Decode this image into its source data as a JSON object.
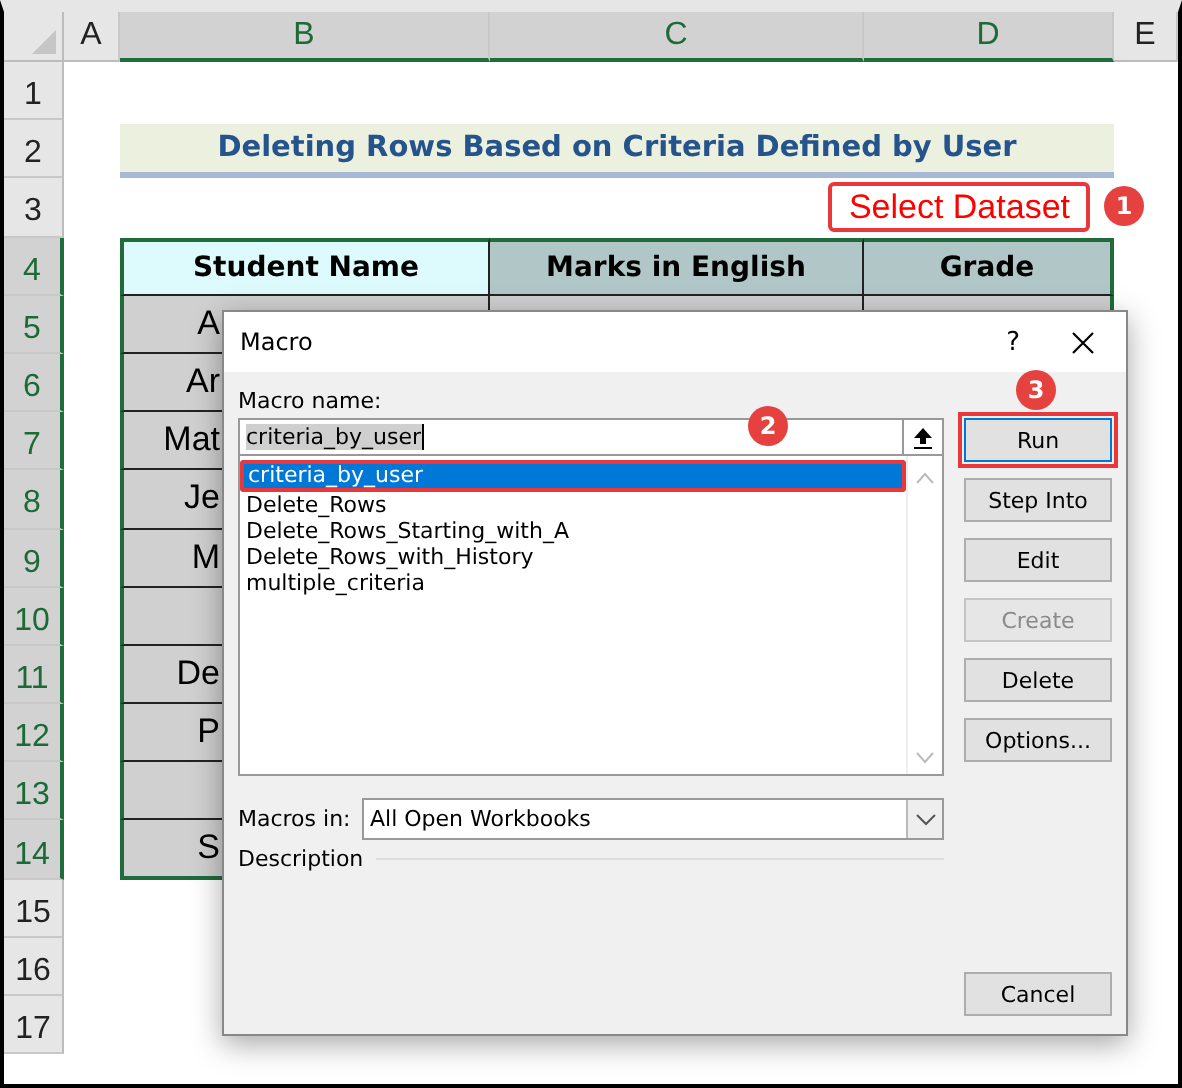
{
  "sheet": {
    "columns": [
      {
        "label": "A",
        "selected": false
      },
      {
        "label": "B",
        "selected": true
      },
      {
        "label": "C",
        "selected": true
      },
      {
        "label": "D",
        "selected": true
      },
      {
        "label": "E",
        "selected": false
      }
    ],
    "rows": [
      {
        "label": "1",
        "selected": false
      },
      {
        "label": "2",
        "selected": false
      },
      {
        "label": "3",
        "selected": false
      },
      {
        "label": "4",
        "selected": true
      },
      {
        "label": "5",
        "selected": true
      },
      {
        "label": "6",
        "selected": true
      },
      {
        "label": "7",
        "selected": true
      },
      {
        "label": "8",
        "selected": true
      },
      {
        "label": "9",
        "selected": true
      },
      {
        "label": "10",
        "selected": true
      },
      {
        "label": "11",
        "selected": true
      },
      {
        "label": "12",
        "selected": true
      },
      {
        "label": "13",
        "selected": true
      },
      {
        "label": "14",
        "selected": true
      },
      {
        "label": "15",
        "selected": false
      },
      {
        "label": "16",
        "selected": false
      },
      {
        "label": "17",
        "selected": false
      }
    ],
    "title": "Deleting Rows Based on Criteria Defined by User",
    "callout": {
      "label": "Select Dataset",
      "step": "1"
    },
    "table": {
      "columns": [
        "Student Name",
        "Marks in English",
        "Grade"
      ],
      "rows": [
        {
          "name": "A"
        },
        {
          "name": "Ar"
        },
        {
          "name": "Mat"
        },
        {
          "name": "Je"
        },
        {
          "name": "M"
        },
        {},
        {
          "name": "De"
        },
        {
          "name": "P"
        },
        {},
        {
          "name": "S"
        }
      ]
    }
  },
  "dialog": {
    "title": "Macro",
    "help": "?",
    "name_label": "Macro name:",
    "name_value": "criteria_by_user",
    "name_step": "2",
    "macros": [
      {
        "label": "criteria_by_user",
        "selected": true,
        "annotated": true
      },
      {
        "label": "Delete_Rows",
        "selected": false,
        "annotated": false
      },
      {
        "label": "Delete_Rows_Starting_with_A",
        "selected": false,
        "annotated": false
      },
      {
        "label": "Delete_Rows_with_History",
        "selected": false,
        "annotated": false
      },
      {
        "label": "multiple_criteria",
        "selected": false,
        "annotated": false
      }
    ],
    "macros_in_label": "Macros in:",
    "macros_in_value": "All Open Workbooks",
    "description_label": "Description",
    "buttons": [
      {
        "label": "Run",
        "disabled": false,
        "annotated": true,
        "step": "3"
      },
      {
        "label": "Step Into",
        "disabled": false,
        "annotated": false
      },
      {
        "label": "Edit",
        "disabled": false,
        "annotated": false
      },
      {
        "label": "Create",
        "disabled": true,
        "annotated": false
      },
      {
        "label": "Delete",
        "disabled": false,
        "annotated": false
      },
      {
        "label": "Options...",
        "disabled": false,
        "annotated": false
      }
    ],
    "cancel": "Cancel"
  }
}
